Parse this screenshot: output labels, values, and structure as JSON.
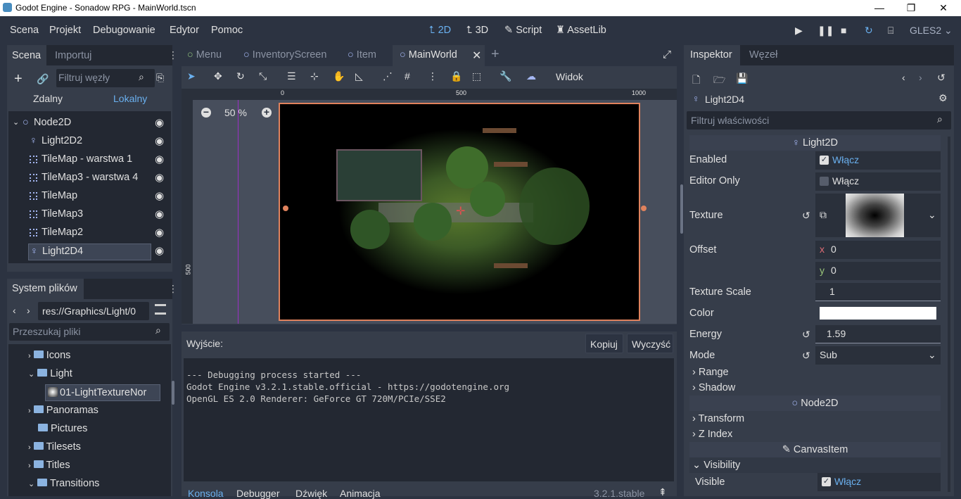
{
  "window": {
    "title": "Godot Engine - Sonadow RPG - MainWorld.tscn",
    "minimize": "—",
    "restore": "❐",
    "close": "✕"
  },
  "menu": [
    "Scena",
    "Projekt",
    "Debugowanie",
    "Edytor",
    "Pomoc"
  ],
  "modes": {
    "m2d": "2D",
    "m3d": "3D",
    "script": "Script",
    "assetlib": "AssetLib"
  },
  "renderer": "GLES2",
  "scene_dock": {
    "tabs": [
      "Scena",
      "Importuj"
    ],
    "filter_placeholder": "Filtruj węzły",
    "remote": "Zdalny",
    "local": "Lokalny",
    "tree": [
      {
        "label": "Node2D",
        "icon": "node2d-icon"
      },
      {
        "label": "Light2D2",
        "icon": "light-icon"
      },
      {
        "label": "TileMap - warstwa 1",
        "icon": "tilemap-icon"
      },
      {
        "label": "TileMap3 - warstwa 4",
        "icon": "tilemap-icon"
      },
      {
        "label": "TileMap",
        "icon": "tilemap-icon"
      },
      {
        "label": "TileMap3",
        "icon": "tilemap-icon"
      },
      {
        "label": "TileMap2",
        "icon": "tilemap-icon"
      },
      {
        "label": "Light2D4",
        "icon": "light-icon"
      }
    ]
  },
  "fs_dock": {
    "title": "System plików",
    "path": "res://Graphics/Light/0",
    "search_placeholder": "Przeszukaj pliki",
    "items": [
      {
        "label": "Icons"
      },
      {
        "label": "Light"
      },
      {
        "label": "01-LightTextureNor"
      },
      {
        "label": "Panoramas"
      },
      {
        "label": "Pictures"
      },
      {
        "label": "Tilesets"
      },
      {
        "label": "Titles"
      },
      {
        "label": "Transitions"
      }
    ]
  },
  "editor_tabs": [
    "Menu",
    "InventoryScreen",
    "Item",
    "MainWorld"
  ],
  "toolbar": {
    "view": "Widok"
  },
  "viewport": {
    "zoom": "50 %",
    "ruler_0": "0",
    "ruler_500": "500",
    "ruler_1000": "1000",
    "ruler_v500": "500"
  },
  "output": {
    "title": "Wyjście:",
    "copy": "Kopiuj",
    "clear": "Wyczyść",
    "lines": [
      "--- Debugging process started ---",
      "Godot Engine v3.2.1.stable.official - https://godotengine.org",
      "OpenGL ES 2.0 Renderer: GeForce GT 720M/PCIe/SSE2"
    ],
    "bottom_tabs": [
      "Konsola",
      "Debugger",
      "Dźwięk",
      "Animacja"
    ],
    "version": "3.2.1.stable"
  },
  "inspector": {
    "tabs": [
      "Inspektor",
      "Węzeł"
    ],
    "node": "Light2D4",
    "filter_placeholder": "Filtruj właściwości",
    "section_light": "Light2D",
    "enabled": "Enabled",
    "editor_only": "Editor Only",
    "on_label": "Włącz",
    "texture": "Texture",
    "offset": "Offset",
    "offset_x": "0",
    "offset_y": "0",
    "texture_scale": "Texture Scale",
    "texture_scale_val": "1",
    "color": "Color",
    "color_value": "#ffffff",
    "energy": "Energy",
    "energy_val": "1.59",
    "mode": "Mode",
    "mode_val": "Sub",
    "range": "Range",
    "shadow": "Shadow",
    "section_node2d": "Node2D",
    "transform": "Transform",
    "zindex": "Z Index",
    "section_canvas": "CanvasItem",
    "visibility": "Visibility",
    "visible": "Visible"
  }
}
